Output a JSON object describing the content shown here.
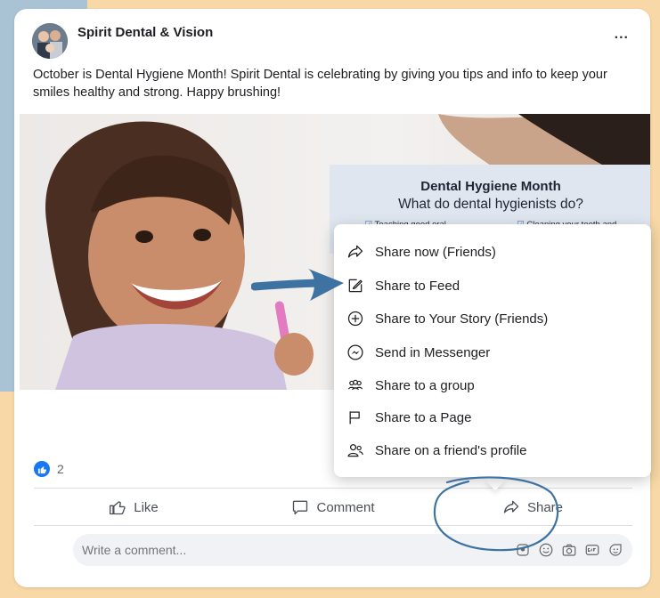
{
  "post": {
    "page_name": "Spirit Dental & Vision",
    "more_label": "...",
    "text": "October is Dental Hygiene Month! Spirit Dental is celebrating by giving you tips and info to keep your smiles healthy and strong. Happy brushing!",
    "image": {
      "title": "Dental Hygiene Month",
      "subtitle": "What do dental hygienists do?",
      "items": [
        "Teaching good oral",
        "Cleaning your teeth and"
      ]
    },
    "reactions": {
      "count": "2"
    }
  },
  "actions": {
    "like": "Like",
    "comment": "Comment",
    "share": "Share"
  },
  "comment_box": {
    "placeholder": "Write a comment..."
  },
  "share_menu": {
    "items": [
      {
        "label": "Share now (Friends)",
        "icon": "share-arrow-icon"
      },
      {
        "label": "Share to Feed",
        "icon": "edit-icon"
      },
      {
        "label": "Share to Your Story (Friends)",
        "icon": "plus-circle-icon"
      },
      {
        "label": "Send in Messenger",
        "icon": "messenger-icon"
      },
      {
        "label": "Share to a group",
        "icon": "group-icon"
      },
      {
        "label": "Share to a Page",
        "icon": "flag-icon"
      },
      {
        "label": "Share on a friend's profile",
        "icon": "friends-icon"
      }
    ]
  },
  "colors": {
    "brand_blue": "#1877f2",
    "annotation_blue": "#3e73a1",
    "background": "#f7d8a6",
    "side_panel": "#a9c3d5"
  }
}
